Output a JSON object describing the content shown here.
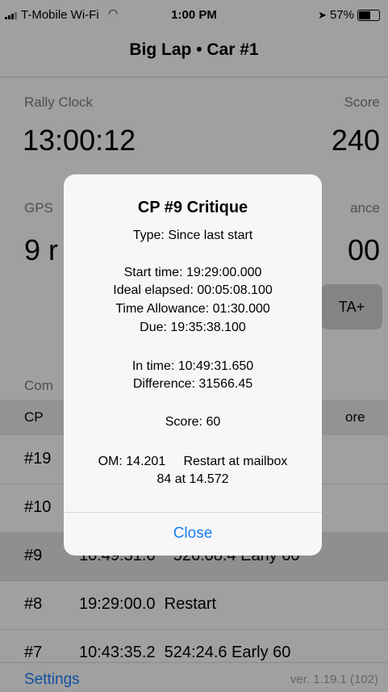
{
  "status": {
    "carrier": "T-Mobile Wi-Fi",
    "time": "1:00 PM",
    "battery": "57%"
  },
  "nav": {
    "title": "Big Lap • Car #1"
  },
  "clock": {
    "label": "Rally Clock",
    "value": "13:00:12"
  },
  "score": {
    "label": "Score",
    "value": "240"
  },
  "gps": {
    "label": "GPS",
    "value": "9 r"
  },
  "allowance": {
    "label": "ance",
    "value": "00"
  },
  "ta_button": "TA+",
  "section_label": "Com",
  "table": {
    "headers": {
      "cp": "CP",
      "score": "ore"
    },
    "rows": [
      {
        "cp": "#19",
        "text": ""
      },
      {
        "cp": "#10",
        "text": ""
      },
      {
        "cp": "#9",
        "text": "10:49:31.6    526:08.4 Early 60"
      },
      {
        "cp": "#8",
        "text": "19:29:00.0  Restart"
      },
      {
        "cp": "#7",
        "text": "10:43:35.2  524:24.6 Early 60"
      }
    ]
  },
  "footer": {
    "settings": "Settings",
    "version": "ver. 1.19.1 (102)"
  },
  "dialog": {
    "title": "CP #9 Critique",
    "type": "Type: Since last start",
    "start_time": "Start time:  19:29:00.000",
    "ideal_elapsed": "Ideal elapsed: 00:05:08.100",
    "time_allowance": "Time Allowance: 01:30.000",
    "due": "Due: 19:35:38.100",
    "in_time": "In time:  10:49:31.650",
    "difference": "Difference: 31566.45",
    "score": "Score:  60",
    "om": "OM: 14.201     Restart at mailbox",
    "om2": "84 at 14.572",
    "close": "Close"
  }
}
